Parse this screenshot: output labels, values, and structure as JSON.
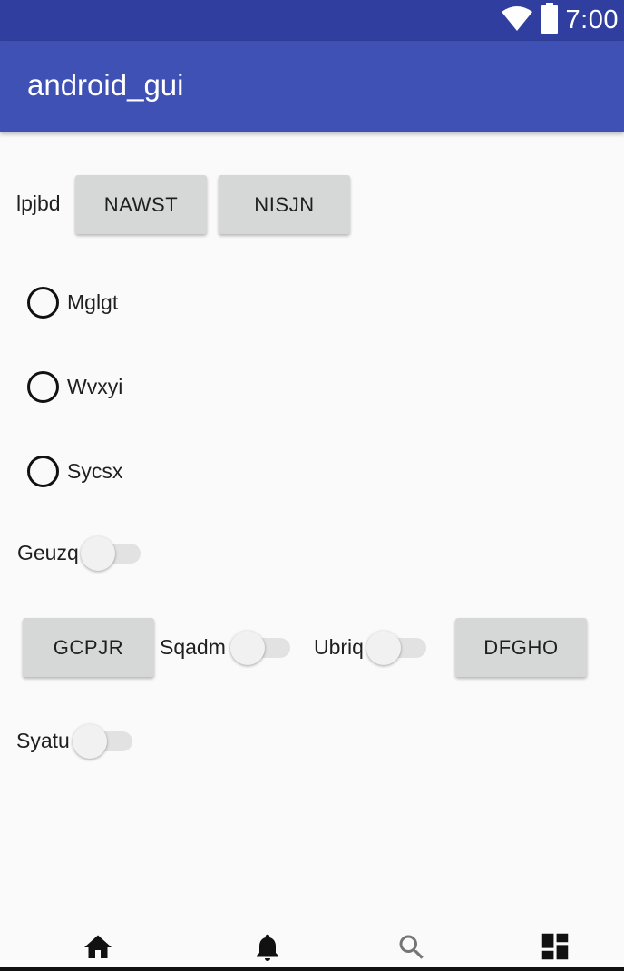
{
  "status_bar": {
    "time": "7:00",
    "icons": [
      "wifi-icon",
      "battery-icon"
    ]
  },
  "app_bar": {
    "title": "android_gui"
  },
  "row1": {
    "label": "lpjbd",
    "button1": "NAWST",
    "button2": "NISJN"
  },
  "radios": [
    {
      "label": "Mglgt"
    },
    {
      "label": "Wvxyi"
    },
    {
      "label": "Sycsx"
    }
  ],
  "switch1": {
    "label": "Geuzq"
  },
  "row2": {
    "button1": "GCPJR",
    "switch_a_label": "Sqadm",
    "switch_b_label": "Ubriq",
    "button2": "DFGHO"
  },
  "switch2": {
    "label": "Syatu"
  },
  "bottom_nav": {
    "items": [
      "home-icon",
      "bell-icon",
      "search-icon",
      "dashboard-icon"
    ]
  },
  "colors": {
    "status_bar": "#303f9f",
    "app_bar": "#3f51b5",
    "background": "#fafafa",
    "button": "#d6d7d7"
  }
}
